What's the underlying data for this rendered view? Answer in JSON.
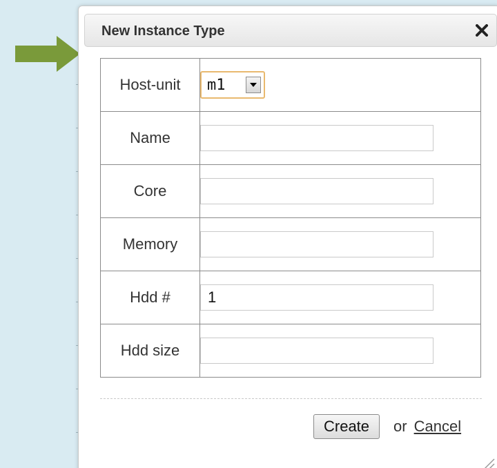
{
  "dialog": {
    "title": "New Instance Type",
    "close_icon": "close-icon"
  },
  "form": {
    "rows": [
      {
        "label": "Host-unit",
        "type": "select",
        "value": "m1"
      },
      {
        "label": "Name",
        "type": "text",
        "value": ""
      },
      {
        "label": "Core",
        "type": "text",
        "value": ""
      },
      {
        "label": "Memory",
        "type": "text",
        "value": ""
      },
      {
        "label": "Hdd #",
        "type": "text",
        "value": "1"
      },
      {
        "label": "Hdd size",
        "type": "text",
        "value": ""
      }
    ]
  },
  "footer": {
    "create_label": "Create",
    "or_text": "or",
    "cancel_label": "Cancel"
  },
  "colors": {
    "backdrop": "#d9ebf2",
    "arrow": "#7a9a3a",
    "select_focus": "#e9b96e"
  },
  "icons": {
    "arrow": "arrow-right-icon",
    "dropdown": "chevron-down-icon",
    "resize": "resize-grip-icon"
  }
}
